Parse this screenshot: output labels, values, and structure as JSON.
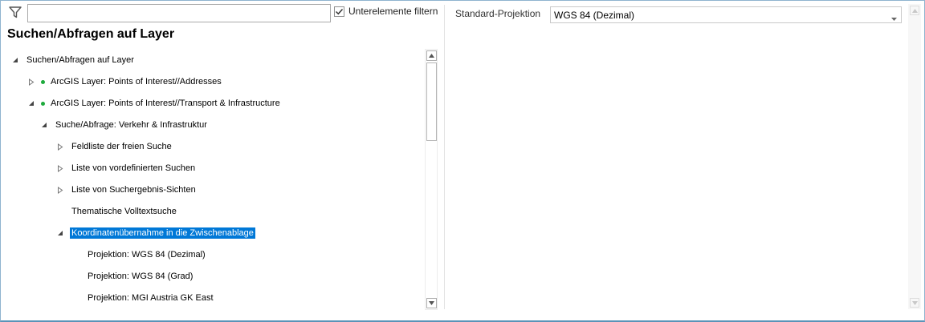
{
  "filter": {
    "icon": "funnel-icon",
    "input_value": "",
    "checkbox_checked": true,
    "checkbox_label": "Unterelemente filtern"
  },
  "panel_title": "Suchen/Abfragen auf Layer",
  "tree": {
    "items": [
      {
        "label": "Suchen/Abfragen auf Layer",
        "state": "expanded",
        "dot": false,
        "selected": false
      },
      {
        "label": "ArcGIS Layer: Points of Interest//Addresses",
        "state": "collapsed",
        "dot": true,
        "selected": false
      },
      {
        "label": "ArcGIS Layer: Points of Interest//Transport & Infrastructure",
        "state": "expanded",
        "dot": true,
        "selected": false
      },
      {
        "label": "Suche/Abfrage: Verkehr & Infrastruktur",
        "state": "expanded",
        "dot": false,
        "selected": false
      },
      {
        "label": "Feldliste der freien Suche",
        "state": "collapsed",
        "dot": false,
        "selected": false
      },
      {
        "label": "Liste von vordefinierten Suchen",
        "state": "collapsed",
        "dot": false,
        "selected": false
      },
      {
        "label": "Liste von Suchergebnis-Sichten",
        "state": "collapsed",
        "dot": false,
        "selected": false
      },
      {
        "label": "Thematische Volltextsuche",
        "state": "leaf",
        "dot": false,
        "selected": false
      },
      {
        "label": "Koordinatenübernahme in die Zwischenablage",
        "state": "expanded",
        "dot": false,
        "selected": true
      },
      {
        "label": "Projektion: WGS 84 (Dezimal)",
        "state": "leaf",
        "dot": false,
        "selected": false
      },
      {
        "label": "Projektion: WGS 84 (Grad)",
        "state": "leaf",
        "dot": false,
        "selected": false
      },
      {
        "label": "Projektion: MGI Austria GK East",
        "state": "leaf",
        "dot": false,
        "selected": false
      }
    ]
  },
  "properties": {
    "standard_projection_label": "Standard-Projektion",
    "standard_projection_value": "WGS 84 (Dezimal)"
  },
  "colors": {
    "selection": "#0078d7",
    "status_dot": "#1eaa3c",
    "frame_border": "#5b93b8"
  }
}
